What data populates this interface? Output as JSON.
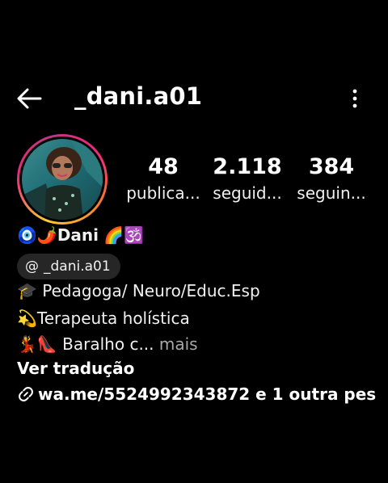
{
  "header": {
    "username": "_dani.a01"
  },
  "stats": [
    {
      "value": "48",
      "label": "publica..."
    },
    {
      "value": "2.118",
      "label": "seguid..."
    },
    {
      "value": "384",
      "label": "seguin..."
    }
  ],
  "bio": {
    "name_prefix": "🧿🌶️",
    "name": "Dani",
    "name_suffix": " 🌈🕉️",
    "threads_handle": "_dani.a01",
    "line1_emoji": "🎓",
    "line1_text": " Pedagoga/ Neuro/Educ.Esp",
    "line2_emoji": "💫",
    "line2_text": "Terapeuta holística",
    "line3_emoji": "💃👠",
    "line3_text": " Baralho c...",
    "more_label": " mais",
    "translate_label": "Ver tradução",
    "link_text": "wa.me/5524992343872 e 1 outra pes..."
  }
}
